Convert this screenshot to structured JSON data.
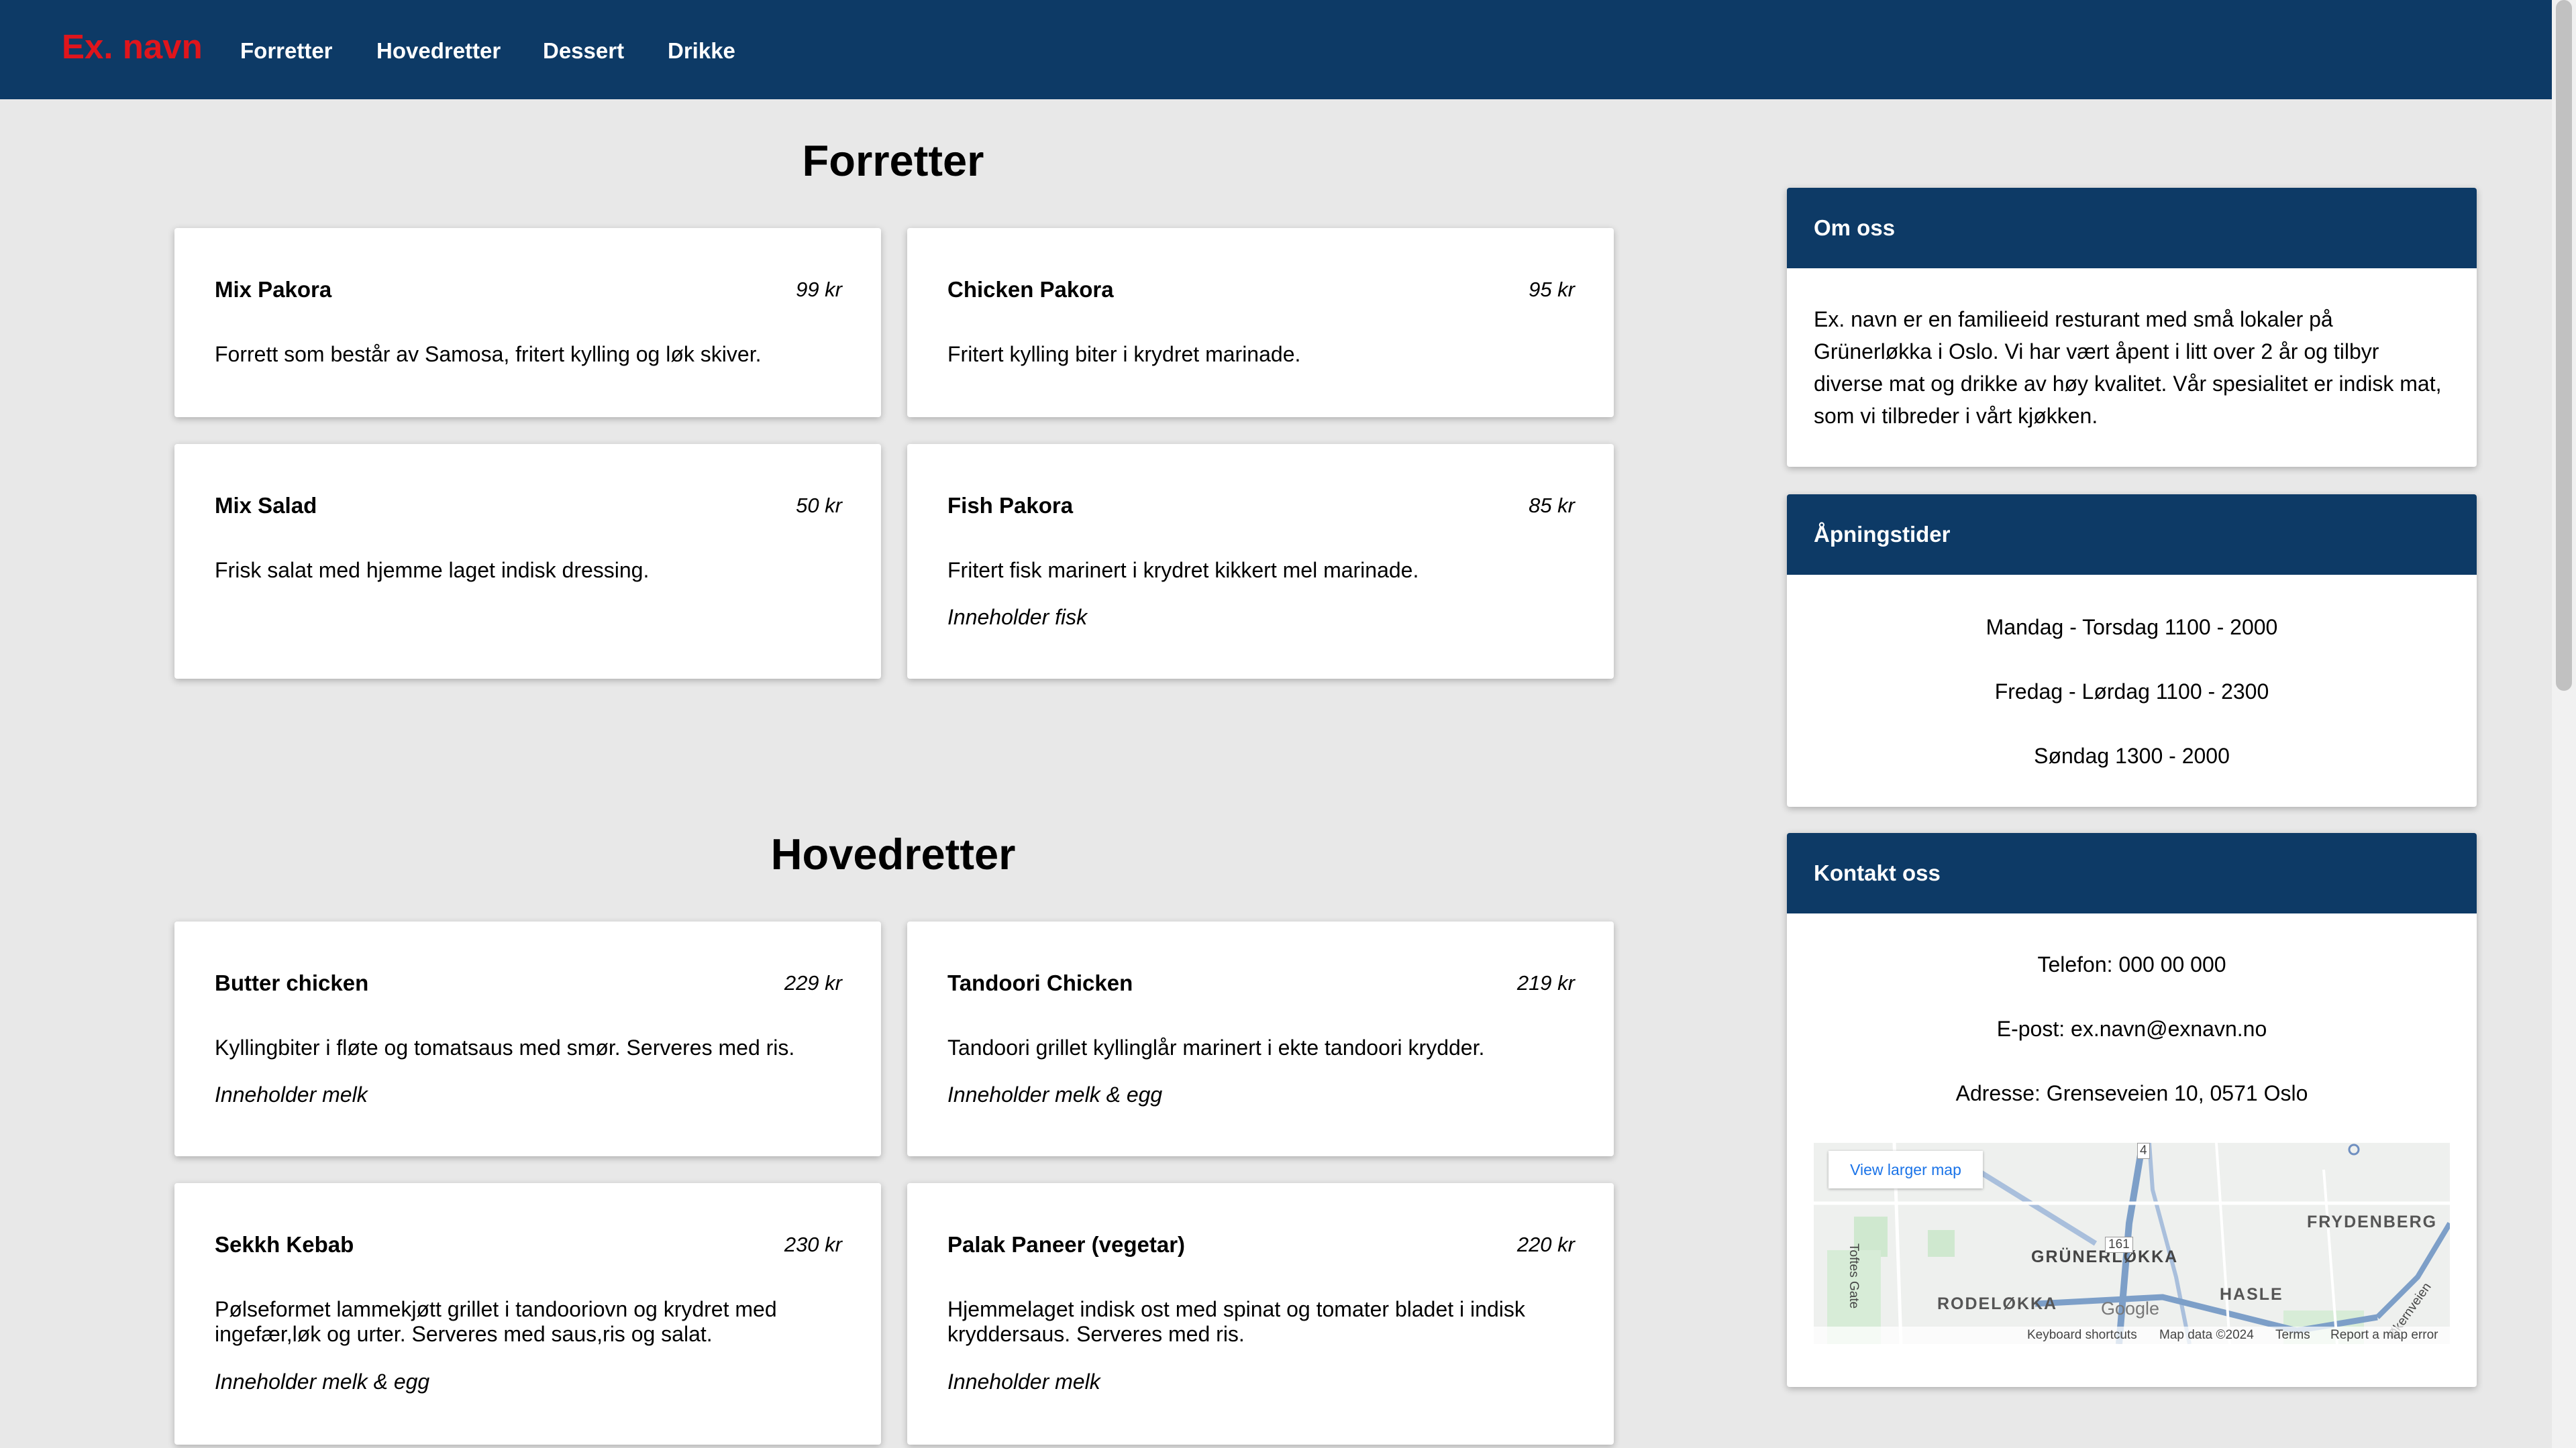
{
  "nav": {
    "logo": "Ex. navn",
    "links": [
      "Forretter",
      "Hovedretter",
      "Dessert",
      "Drikke"
    ]
  },
  "sections": {
    "forretter": {
      "title": "Forretter",
      "items": [
        {
          "name": "Mix Pakora",
          "price": "99 kr",
          "desc": "Forrett som består av Samosa, fritert kylling og løk skiver.",
          "note": ""
        },
        {
          "name": "Chicken Pakora",
          "price": "95 kr",
          "desc": "Fritert kylling biter i krydret marinade.",
          "note": ""
        },
        {
          "name": "Mix Salad",
          "price": "50 kr",
          "desc": "Frisk salat med hjemme laget indisk dressing.",
          "note": ""
        },
        {
          "name": "Fish Pakora",
          "price": "85 kr",
          "desc": "Fritert fisk marinert i krydret kikkert mel marinade.",
          "note": "Inneholder fisk"
        }
      ]
    },
    "hovedretter": {
      "title": "Hovedretter",
      "items": [
        {
          "name": "Butter chicken",
          "price": "229 kr",
          "desc": "Kyllingbiter i fløte og tomatsaus med smør. Serveres med ris.",
          "note": "Inneholder melk"
        },
        {
          "name": "Tandoori Chicken",
          "price": "219 kr",
          "desc": "Tandoori grillet kyllinglår marinert i ekte tandoori krydder.",
          "note": "Inneholder melk & egg"
        },
        {
          "name": "Sekkh Kebab",
          "price": "230 kr",
          "desc": "Pølseformet lammekjøtt grillet i tandooriovn og krydret med ingefær,løk og urter. Serveres med saus,ris og salat.",
          "note": "Inneholder melk & egg"
        },
        {
          "name": "Palak Paneer (vegetar)",
          "price": "220 kr",
          "desc": "Hjemmelaget indisk ost med spinat og tomater bladet i indisk kryddersaus. Serveres med ris.",
          "note": "Inneholder melk"
        }
      ]
    }
  },
  "sidebar": {
    "about": {
      "title": "Om oss",
      "text": "Ex. navn er en familieeid resturant med små lokaler på Grünerløkka i Oslo. Vi har vært åpent i litt over 2 år og tilbyr diverse mat og drikke av høy kvalitet. Vår spesialitet er indisk mat, som vi tilbreder i vårt kjøkken."
    },
    "hours": {
      "title": "Åpningstider",
      "lines": [
        "Mandag - Torsdag 1100 - 2000",
        "Fredag - Lørdag 1100 - 2300",
        "Søndag 1300 - 2000"
      ]
    },
    "contact": {
      "title": "Kontakt oss",
      "phone": "Telefon: 000 00 000",
      "email": "E-post: ex.navn@exnavn.no",
      "address": "Adresse: Grenseveien 10, 0571 Oslo",
      "map": {
        "button": "View larger map",
        "labels": [
          "FRYDENBERG",
          "GRÜNERLØKKA",
          "RODELØKKA",
          "HASLE",
          "Toftes Gate",
          "Økernveien",
          "161",
          "4"
        ],
        "brand": "Google",
        "footer": [
          "Keyboard shortcuts",
          "Map data ©2024",
          "Terms",
          "Report a map error"
        ]
      }
    }
  },
  "colors": {
    "nav_bg": "#0d3a66",
    "logo": "#e0151c",
    "page_bg": "#e8e8e8"
  }
}
